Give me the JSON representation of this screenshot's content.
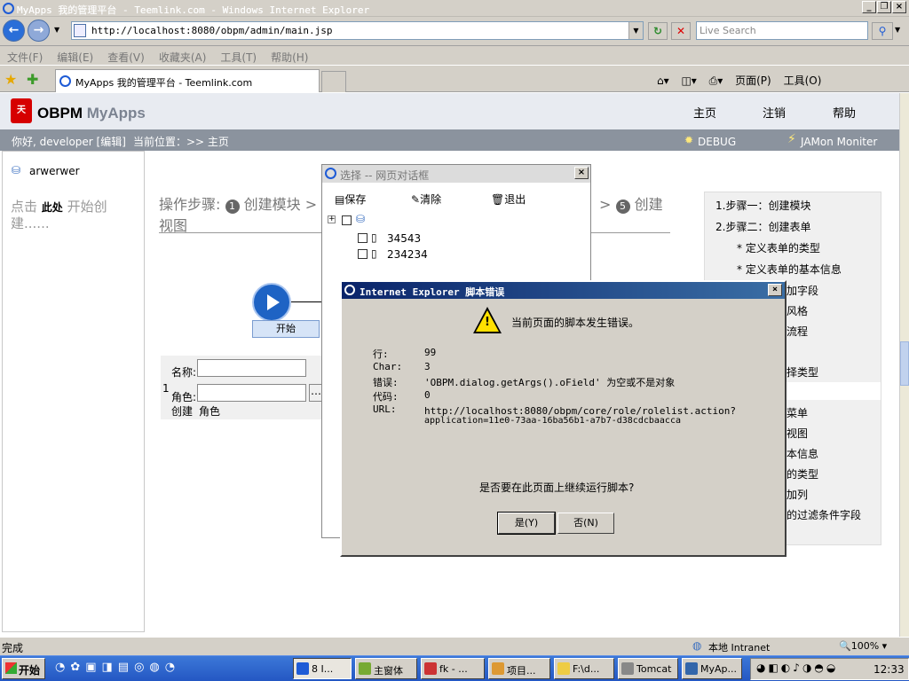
{
  "window": {
    "title": "MyApps 我的管理平台 - Teemlink.com - Windows Internet Explorer"
  },
  "browser": {
    "url": "http://localhost:8080/obpm/admin/main.jsp",
    "search_placeholder": "Live Search",
    "menu": [
      "文件(F)",
      "编辑(E)",
      "查看(V)",
      "收藏夹(A)",
      "工具(T)",
      "帮助(H)"
    ],
    "tab_title": "MyApps 我的管理平台 - Teemlink.com",
    "page_menu": "页面(P)",
    "tools_menu": "工具(O)"
  },
  "app": {
    "brand_a": "OBPM",
    "brand_b": "MyApps",
    "nav": [
      "主页",
      "注销",
      "帮助"
    ],
    "greeting": "你好, developer [编辑]",
    "location": "当前位置：>> 主页",
    "debug": "DEBUG",
    "jamon": "JAMon Moniter",
    "sidebar_user": "arwerwer",
    "sidebar_hint_a": "点击",
    "sidebar_hint_b": "此处",
    "sidebar_hint_c": "开始创建......",
    "steps_a": "操作步骤:",
    "steps_1": "创建模块",
    "steps_tail": "视图",
    "steps_5": "创建",
    "right_panel": [
      "1.步骤一：创建模块",
      "2.步骤二：创建表单",
      "* 定义表单的类型",
      "* 定义表单的基本信息",
      "加字段",
      "风格",
      "流程",
      "择类型",
      "菜单",
      "视图",
      "本信息",
      "的类型",
      "加列",
      "的过滤条件字段"
    ],
    "flow_start": "开始",
    "form_name": "名称:",
    "form_role": "角色:",
    "form_create": "创建",
    "form_role2": "角色",
    "form_index": "1"
  },
  "select_dialog": {
    "title": "选择 -- 网页对话框",
    "save": "保存",
    "clear": "清除",
    "exit": "退出",
    "items": [
      "34543",
      "234234"
    ]
  },
  "error_dialog": {
    "title": "Internet Explorer 脚本错误",
    "message": "当前页面的脚本发生错误。",
    "fields": [
      {
        "label": "行:",
        "value": "99"
      },
      {
        "label": "Char:",
        "value": "3"
      },
      {
        "label": "错误:",
        "value": "'OBPM.dialog.getArgs().oField' 为空或不是对象"
      },
      {
        "label": "代码:",
        "value": "0"
      },
      {
        "label": "URL:",
        "value": "http://localhost:8080/obpm/core/role/rolelist.action?"
      }
    ],
    "url_line2": "application=11e0-73aa-16ba56b1-a7b7-d38cdcbaacca",
    "question": "是否要在此页面上继续运行脚本?",
    "yes": "是(Y)",
    "no": "否(N)"
  },
  "status": {
    "text": "完成",
    "zone": "本地 Intranet",
    "zoom": "100%"
  },
  "taskbar": {
    "start": "开始",
    "tasks": [
      "8 I...",
      "主窗体",
      "fk - ...",
      "项目...",
      "F:\\d...",
      "Tomcat",
      "MyAp..."
    ],
    "clock": "12:33"
  }
}
